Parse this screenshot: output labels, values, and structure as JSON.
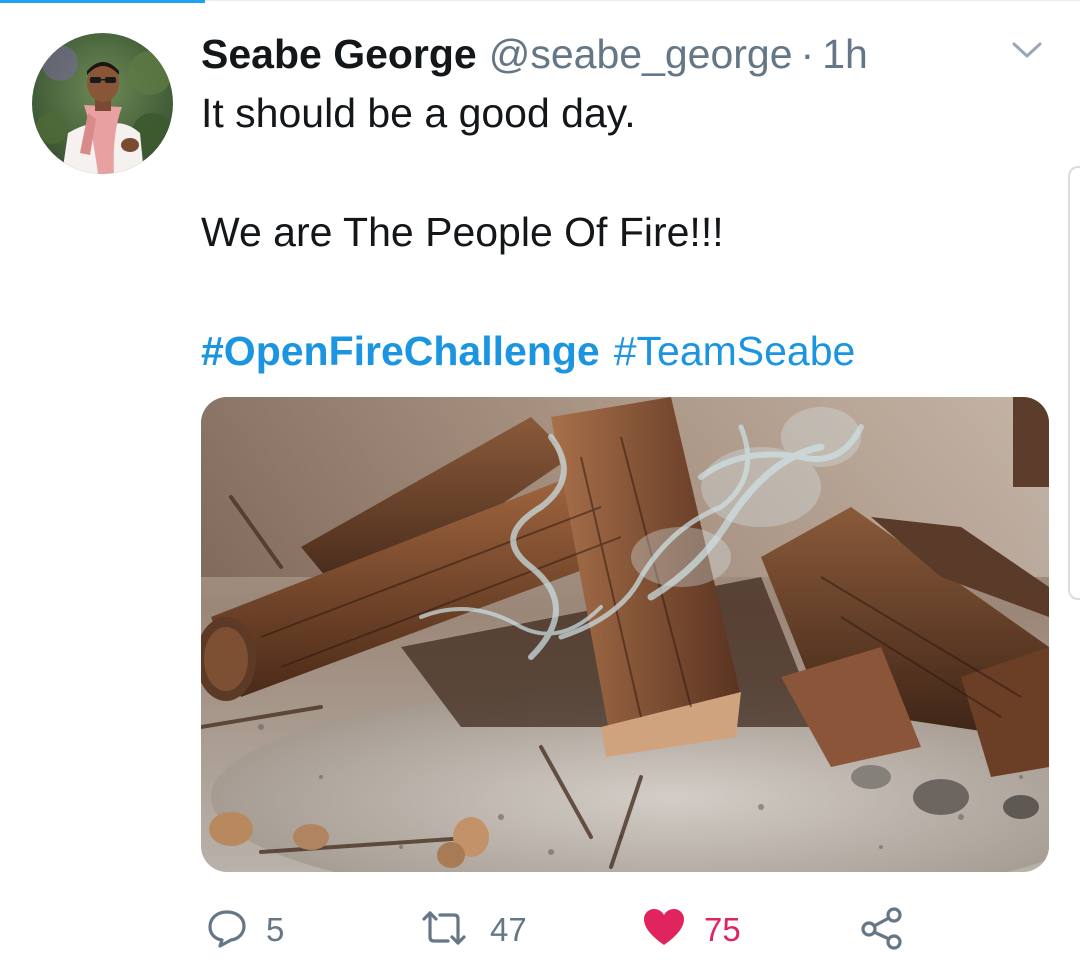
{
  "tweet": {
    "display_name": "Seabe George",
    "handle": "@seabe_george",
    "separator": "·",
    "time": "1h",
    "text_line1": "It should be a good day.",
    "text_line2": "We are The People Of Fire!!!",
    "hashtag1": "#OpenFireChallenge",
    "hashtag2": "#TeamSeabe"
  },
  "actions": {
    "replies": "5",
    "retweets": "47",
    "likes": "75"
  },
  "colors": {
    "accent": "#1da1f2",
    "hashtag": "#1b95e0",
    "like": "#e0245e",
    "muted": "#657786"
  },
  "icons": {
    "reply": "reply-icon",
    "retweet": "retweet-icon",
    "like": "heart-icon",
    "share": "share-icon",
    "menu": "chevron-down-icon"
  }
}
